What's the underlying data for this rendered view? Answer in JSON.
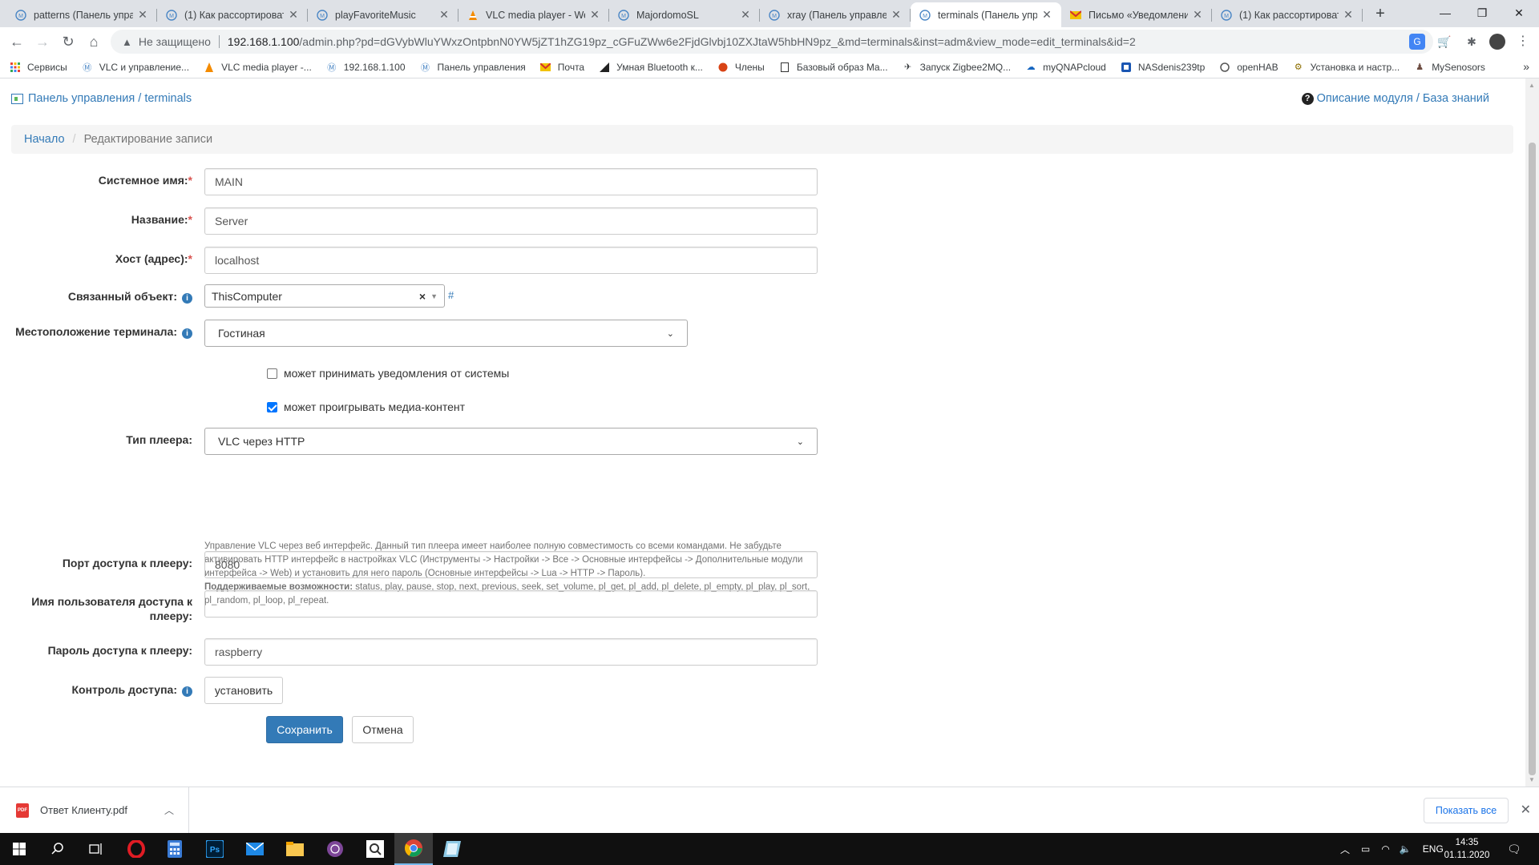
{
  "browser": {
    "tabs": [
      {
        "title": "patterns (Панель управ",
        "favicon": "m"
      },
      {
        "title": "(1) Как рассортироват",
        "favicon": "m"
      },
      {
        "title": "playFavoriteMusic",
        "favicon": "m"
      },
      {
        "title": "VLC media player - Wel",
        "favicon": "vlc"
      },
      {
        "title": "MajordomoSL",
        "favicon": "m"
      },
      {
        "title": "xray (Панель управлен",
        "favicon": "m"
      },
      {
        "title": "terminals (Панель упр",
        "favicon": "m"
      },
      {
        "title": "Письмо «Уведомлени",
        "favicon": "mail"
      },
      {
        "title": "(1) Как рассортироват",
        "favicon": "m"
      }
    ],
    "address": {
      "security_label": "Не защищено",
      "url_host": "192.168.1.100",
      "url_path": "/admin.php?pd=dGVybWluYWxzOntpbnN0YW5jZT1hZG19pz_cGFuZWw6e2FjdGlvbj10ZXJtaW5hbHN9pz_&md=terminals&inst=adm&view_mode=edit_terminals&id=2"
    },
    "bookmarks": [
      {
        "label": "Сервисы",
        "icon": "apps"
      },
      {
        "label": "VLC и управление...",
        "icon": "m"
      },
      {
        "label": "VLC media player -...",
        "icon": "vlc"
      },
      {
        "label": "192.168.1.100",
        "icon": "m"
      },
      {
        "label": "Панель управления",
        "icon": "m"
      },
      {
        "label": "Почта",
        "icon": "mail"
      },
      {
        "label": "Умная Bluetooth к...",
        "icon": "flag"
      },
      {
        "label": "Члены",
        "icon": "shell"
      },
      {
        "label": "Базовый образ Ma...",
        "icon": "doc"
      },
      {
        "label": "Запуск Zigbee2MQ...",
        "icon": "plane"
      },
      {
        "label": "myQNAPcloud",
        "icon": "cloud"
      },
      {
        "label": "NASdenis239tp",
        "icon": "nas"
      },
      {
        "label": "openHAB",
        "icon": "oh"
      },
      {
        "label": "Установка и настр...",
        "icon": "gear"
      },
      {
        "label": "MySenosors",
        "icon": "person"
      }
    ]
  },
  "page": {
    "top_crumb": {
      "part1": "Панель управления",
      "sep": " / ",
      "part2": "terminals"
    },
    "help": {
      "module_desc": "Описание модуля",
      "sep": " / ",
      "kb": "База знаний"
    },
    "breadcrumb": {
      "home": "Начало",
      "sep": "/",
      "current": "Редактирование записи"
    },
    "form": {
      "system_name": {
        "label": "Системное имя:",
        "required": "*",
        "value": "MAIN"
      },
      "title": {
        "label": "Название:",
        "required": "*",
        "value": "Server"
      },
      "host": {
        "label": "Хост (адрес):",
        "required": "*",
        "value": "localhost"
      },
      "linked_object": {
        "label": "Связанный объект:",
        "value": "ThisComputer",
        "clear": "×",
        "hash": "#"
      },
      "location": {
        "label": "Местоположение терминала:",
        "value": "Гостиная"
      },
      "can_notify": {
        "label": "может принимать уведомления от системы",
        "checked": false
      },
      "can_play": {
        "label": "может проигрывать медиа-контент",
        "checked": true
      },
      "player_type": {
        "label": "Тип плеера:",
        "value": "VLC через HTTP"
      },
      "player_help": {
        "text": "Управление VLC через веб интерфейс. Данный тип плеера имеет наиболее полную совместимость со всеми командами. Не забудьте активировать HTTP интерфейс в настройках VLC (Инструменты -> Настройки -> Все -> Основные интерфейсы -> Дополнительные модули интерфейса -> Web) и установить для него пароль (Основные интерфейсы -> Lua -> HTTP -> Пароль).",
        "caps_label": "Поддерживаемые возможности:",
        "caps": " status, play, pause, stop, next, previous, seek, set_volume, pl_get, pl_add, pl_delete, pl_empty, pl_play, pl_sort, pl_random, pl_loop, pl_repeat."
      },
      "player_port": {
        "label": "Порт доступа к плееру:",
        "value": "8080"
      },
      "player_user": {
        "label_line1": "Имя пользователя доступа к",
        "label_line2": "плееру:",
        "value": ""
      },
      "player_password": {
        "label": "Пароль доступа к плееру:",
        "value": "raspberry"
      },
      "access_control": {
        "label": "Контроль доступа:",
        "button": "установить"
      },
      "save": "Сохранить",
      "cancel": "Отмена"
    }
  },
  "downloads": {
    "file": "Ответ Клиенту.pdf",
    "show_all": "Показать все"
  },
  "taskbar": {
    "lang": "ENG",
    "time": "14:35",
    "date": "01.11.2020"
  },
  "colors": {
    "link": "#337ab7",
    "primary": "#337ab7",
    "required": "#d9534f",
    "checkbox": "#0075ff"
  }
}
